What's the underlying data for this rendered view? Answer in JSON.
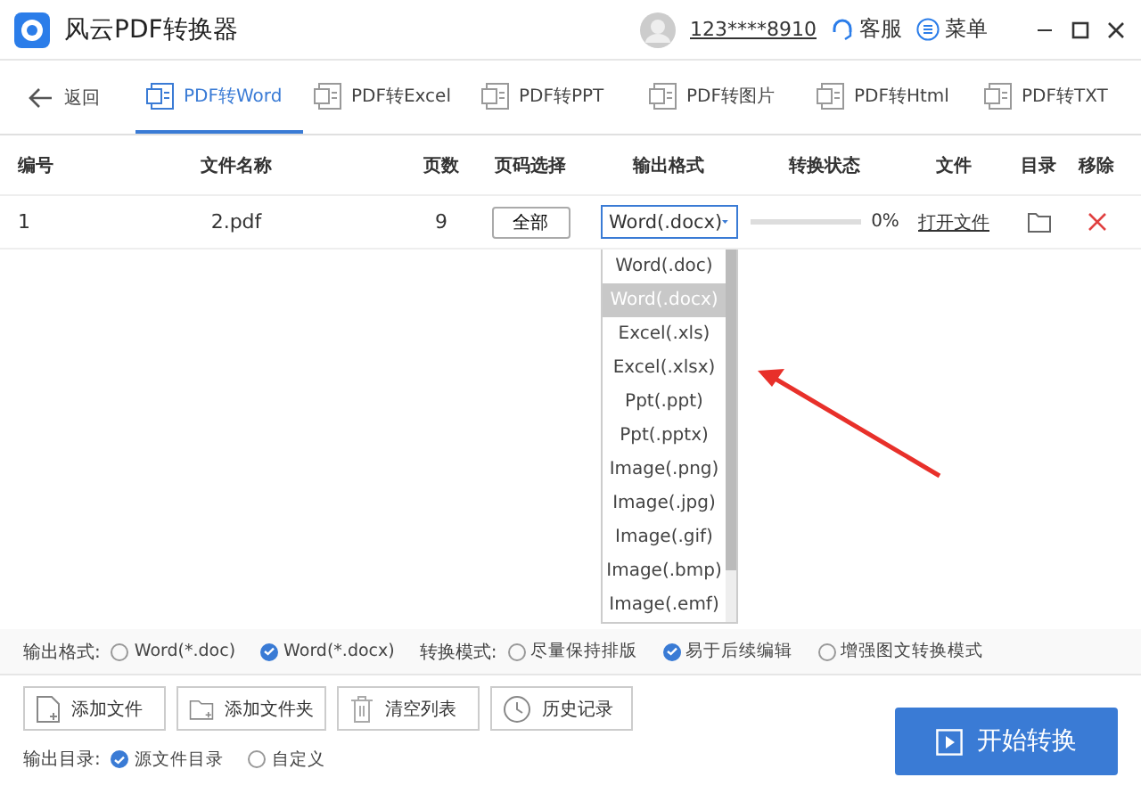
{
  "window": {
    "app_title": "风云PDF转换器",
    "account": "123****8910",
    "support": "客服",
    "menu": "菜单"
  },
  "nav": {
    "back": "返回",
    "tabs": [
      {
        "label": "PDF转Word",
        "selected": true
      },
      {
        "label": "PDF转Excel",
        "selected": false
      },
      {
        "label": "PDF转PPT",
        "selected": false
      },
      {
        "label": "PDF转图片",
        "selected": false
      },
      {
        "label": "PDF转Html",
        "selected": false
      },
      {
        "label": "PDF转TXT",
        "selected": false
      }
    ]
  },
  "table": {
    "columns": [
      "编号",
      "文件名称",
      "页数",
      "页码选择",
      "输出格式",
      "转换状态",
      "文件",
      "目录",
      "移除"
    ],
    "rows": [
      {
        "index": "1",
        "name": "2.pdf",
        "pages": "9",
        "page_select": "全部",
        "format": "Word(.docx)",
        "level": 0,
        "progress": "0%",
        "open_file": "打开文件"
      }
    ]
  },
  "dropdown": {
    "options": [
      {
        "label": "Word(.doc)",
        "selected": false
      },
      {
        "label": "Word(.docx)",
        "selected": true
      },
      {
        "label": "Excel(.xls)",
        "selected": false
      },
      {
        "label": "Excel(.xlsx)",
        "selected": false
      },
      {
        "label": "Ppt(.ppt)",
        "selected": false
      },
      {
        "label": "Ppt(.pptx)",
        "selected": false
      },
      {
        "label": "Image(.png)",
        "selected": false
      },
      {
        "label": "Image(.jpg)",
        "selected": false
      },
      {
        "label": "Image(.gif)",
        "selected": false
      },
      {
        "label": "Image(.bmp)",
        "selected": false
      },
      {
        "label": "Image(.emf)",
        "selected": false
      }
    ]
  },
  "options": {
    "format_label": "输出格式:",
    "formats": [
      {
        "label": "Word(*.doc)",
        "selected": false
      },
      {
        "label": "Word(*.docx)",
        "selected": true
      }
    ],
    "mode_label": "转换模式:",
    "modes": [
      {
        "label": "尽量保持排版",
        "selected": false
      },
      {
        "label": "易于后续编辑",
        "selected": true
      },
      {
        "label": "增强图文转换模式",
        "selected": false
      }
    ]
  },
  "buttons": [
    {
      "label": "添加文件",
      "kind": "file"
    },
    {
      "label": "添加文件夹",
      "kind": "folder"
    },
    {
      "label": "清空列表",
      "kind": "trash"
    },
    {
      "label": "历史记录",
      "kind": "clock"
    }
  ],
  "output_dir": {
    "label": "输出目录:",
    "choices": [
      {
        "label": "源文件目录",
        "selected": true
      },
      {
        "label": "自定义",
        "selected": false
      }
    ]
  },
  "start_button": "开始转换"
}
